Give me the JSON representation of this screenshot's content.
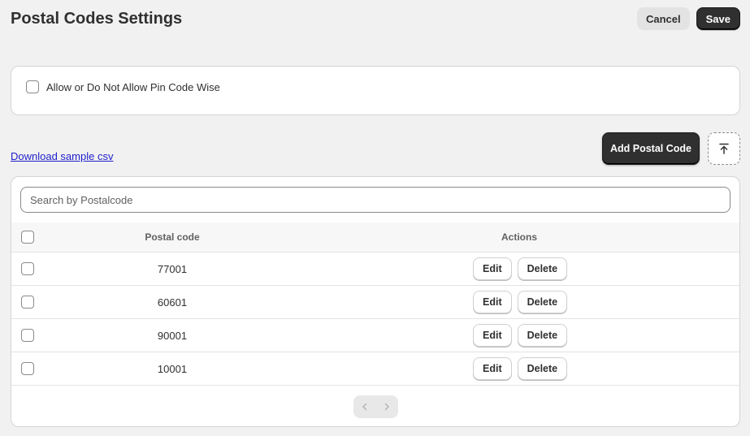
{
  "header": {
    "title": "Postal Codes Settings",
    "cancel_label": "Cancel",
    "save_label": "Save"
  },
  "setting": {
    "label": "Allow or Do Not Allow Pin Code Wise",
    "checked": false
  },
  "toolbar": {
    "download_link": "Download sample csv",
    "add_label": "Add Postal Code",
    "upload_icon": "upload-icon"
  },
  "search": {
    "placeholder": "Search by Postalcode",
    "value": ""
  },
  "table": {
    "columns": [
      "Postal code",
      "Actions"
    ],
    "rows": [
      {
        "code": "77001",
        "edit": "Edit",
        "delete": "Delete"
      },
      {
        "code": "60601",
        "edit": "Edit",
        "delete": "Delete"
      },
      {
        "code": "90001",
        "edit": "Edit",
        "delete": "Delete"
      },
      {
        "code": "10001",
        "edit": "Edit",
        "delete": "Delete"
      }
    ]
  },
  "pagination": {
    "prev_icon": "chevron-left-icon",
    "next_icon": "chevron-right-icon"
  },
  "colors": {
    "primary_button": "#303030",
    "link": "#1e1ecc",
    "background": "#f1f1f1"
  }
}
